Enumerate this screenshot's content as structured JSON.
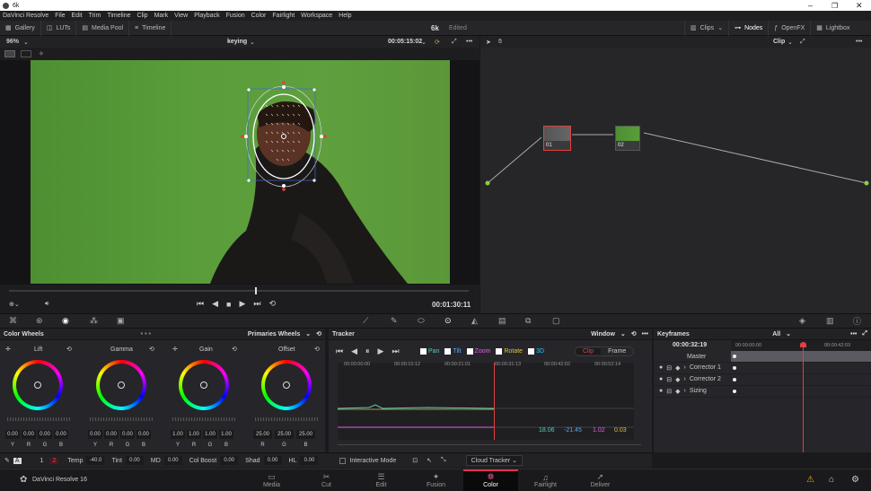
{
  "window": {
    "title": "6k"
  },
  "menu": [
    "DaVinci Resolve",
    "File",
    "Edit",
    "Trim",
    "Timeline",
    "Clip",
    "Mark",
    "View",
    "Playback",
    "Fusion",
    "Color",
    "Fairlight",
    "Workspace",
    "Help"
  ],
  "toolbar": {
    "left": [
      {
        "label": "Gallery",
        "icon": "gallery-icon"
      },
      {
        "label": "LUTs",
        "icon": "luts-icon"
      },
      {
        "label": "Media Pool",
        "icon": "media-pool-icon"
      },
      {
        "label": "Timeline",
        "icon": "timeline-icon"
      }
    ],
    "project_name": "6k",
    "project_status": "Edited",
    "right": [
      {
        "label": "Clips",
        "icon": "clips-icon"
      },
      {
        "label": "Nodes",
        "icon": "nodes-icon"
      },
      {
        "label": "OpenFX",
        "icon": "openfx-icon"
      },
      {
        "label": "Lightbox",
        "icon": "lightbox-icon"
      }
    ]
  },
  "viewer": {
    "zoom": "96%",
    "clip_name": "keying",
    "source_timecode": "00:05:15:02",
    "timecode": "00:01:30:11",
    "options": "•••"
  },
  "nodes": {
    "mode": "Clip",
    "options": "•••",
    "node1": "01",
    "node2": "02"
  },
  "color_wheels": {
    "title": "Color Wheels",
    "mode": "Primaries Wheels",
    "wheels": [
      {
        "name": "Lift",
        "values": [
          "0.00",
          "0.00",
          "0.00",
          "0.00"
        ]
      },
      {
        "name": "Gamma",
        "values": [
          "0.00",
          "0.00",
          "0.00",
          "0.00"
        ]
      },
      {
        "name": "Gain",
        "values": [
          "1.00",
          "1.00",
          "1.00",
          "1.00"
        ]
      },
      {
        "name": "Offset",
        "values": [
          "25.00",
          "25.00",
          "25.00"
        ]
      }
    ],
    "channels4": [
      "Y",
      "R",
      "G",
      "B"
    ],
    "channels3": [
      "R",
      "G",
      "B"
    ]
  },
  "adjustments": {
    "page1": "1",
    "page2": "2",
    "items": [
      {
        "label": "Temp",
        "value": "-40.0"
      },
      {
        "label": "Tint",
        "value": "0.00"
      },
      {
        "label": "MD",
        "value": "0.00"
      },
      {
        "label": "Col Boost",
        "value": "0.00"
      },
      {
        "label": "Shad",
        "value": "0.00"
      },
      {
        "label": "HL",
        "value": "0.00"
      }
    ]
  },
  "tracker": {
    "title": "Tracker",
    "mode": "Window",
    "options": "•••",
    "checks": [
      {
        "label": "Pan",
        "color": "#4fd0c0"
      },
      {
        "label": "Tilt",
        "color": "#5aa8ff"
      },
      {
        "label": "Zoom",
        "color": "#e060e0"
      },
      {
        "label": "Rotate",
        "color": "#e0c040"
      },
      {
        "label": "3D",
        "color": "#30c0ff"
      }
    ],
    "clip_btn": "Clip",
    "frame_btn": "Frame",
    "ruler": [
      "00:00:00:00",
      "00:00:10:12",
      "00:00:21:01",
      "00:00:31:13",
      "00:00:42:02",
      "00:00:52:14"
    ],
    "readouts": [
      {
        "value": "18.06",
        "color": "#4fd0c0"
      },
      {
        "value": "-21.45",
        "color": "#5aa8ff"
      },
      {
        "value": "1.02",
        "color": "#e060e0"
      },
      {
        "value": "0.03",
        "color": "#e0c040"
      }
    ],
    "interactive_mode": "Interactive Mode",
    "cloud_tracker": "Cloud Tracker"
  },
  "keyframes": {
    "title": "Keyframes",
    "filter": "All",
    "options": "•••",
    "timecode": "00:00:32:19",
    "ruler": [
      "00:00:00:00",
      "00:00:42:03"
    ],
    "rows": [
      "Master",
      "Corrector 1",
      "Corrector 2",
      "Sizing"
    ]
  },
  "pages": {
    "app_name": "DaVinci Resolve 16",
    "items": [
      {
        "label": "Media",
        "icon": "media-icon"
      },
      {
        "label": "Cut",
        "icon": "cut-icon"
      },
      {
        "label": "Edit",
        "icon": "edit-icon"
      },
      {
        "label": "Fusion",
        "icon": "fusion-icon"
      },
      {
        "label": "Color",
        "icon": "color-icon",
        "active": true
      },
      {
        "label": "Fairlight",
        "icon": "fairlight-icon"
      },
      {
        "label": "Deliver",
        "icon": "deliver-icon"
      }
    ]
  },
  "colors": {
    "accent": "#e03050",
    "playhead": "#e04040"
  }
}
